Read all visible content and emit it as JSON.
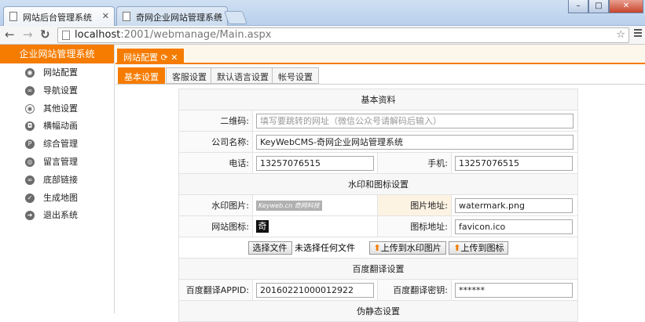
{
  "browser": {
    "tabs": [
      {
        "title": "网站后台管理系统"
      },
      {
        "title": "奇网企业网站管理系统"
      }
    ],
    "url_host": "localhost",
    "url_path": ":2001/webmanage/Main.aspx"
  },
  "sidebar": {
    "title": "企业网站管理系统",
    "items": [
      {
        "label": "网站配置",
        "icon": "gear-icon"
      },
      {
        "label": "导航设置",
        "icon": "link-icon"
      },
      {
        "label": "其他设置",
        "icon": "cog-icon"
      },
      {
        "label": "横幅动画",
        "icon": "camera-icon"
      },
      {
        "label": "综合管理",
        "icon": "p-icon"
      },
      {
        "label": "留言管理",
        "icon": "message-icon"
      },
      {
        "label": "底部链接",
        "icon": "link-icon"
      },
      {
        "label": "生成地图",
        "icon": "check-icon"
      },
      {
        "label": "退出系统",
        "icon": "exit-icon"
      }
    ]
  },
  "main": {
    "tab_label": "网站配置",
    "subtabs": [
      "基本设置",
      "客服设置",
      "默认语言设置",
      "帐号设置"
    ],
    "sections": {
      "basic": "基本资料",
      "watermark": "水印和图标设置",
      "translate": "百度翻译设置",
      "partial": "伪静态设置"
    },
    "fields": {
      "qrcode_label": "二维码:",
      "qrcode_placeholder": "填写要跳转的网址（微信公众号请解码后输入）",
      "company_label": "公司名称:",
      "company_value": "KeyWebCMS-奇网企业网站管理系统",
      "phone_label": "电话:",
      "phone_value": "13257076515",
      "mobile_label": "手机:",
      "mobile_value": "13257076515",
      "wm_image_label": "水印图片:",
      "wm_image_text": "Keyweb.cn 奇网科技",
      "wm_path_label": "图片地址:",
      "wm_path_value": "watermark.png",
      "site_icon_label": "网站图标:",
      "site_icon_glyph": "奇",
      "icon_path_label": "图标地址:",
      "icon_path_value": "favicon.ico",
      "choose_file": "选择文件",
      "no_file": "未选择任何文件",
      "upload_wm": "上传到水印图片",
      "upload_icon": "上传到图标",
      "appid_label": "百度翻译APPID:",
      "appid_value": "20160221000012922",
      "key_label": "百度翻译密钥:",
      "key_value": "******"
    }
  }
}
